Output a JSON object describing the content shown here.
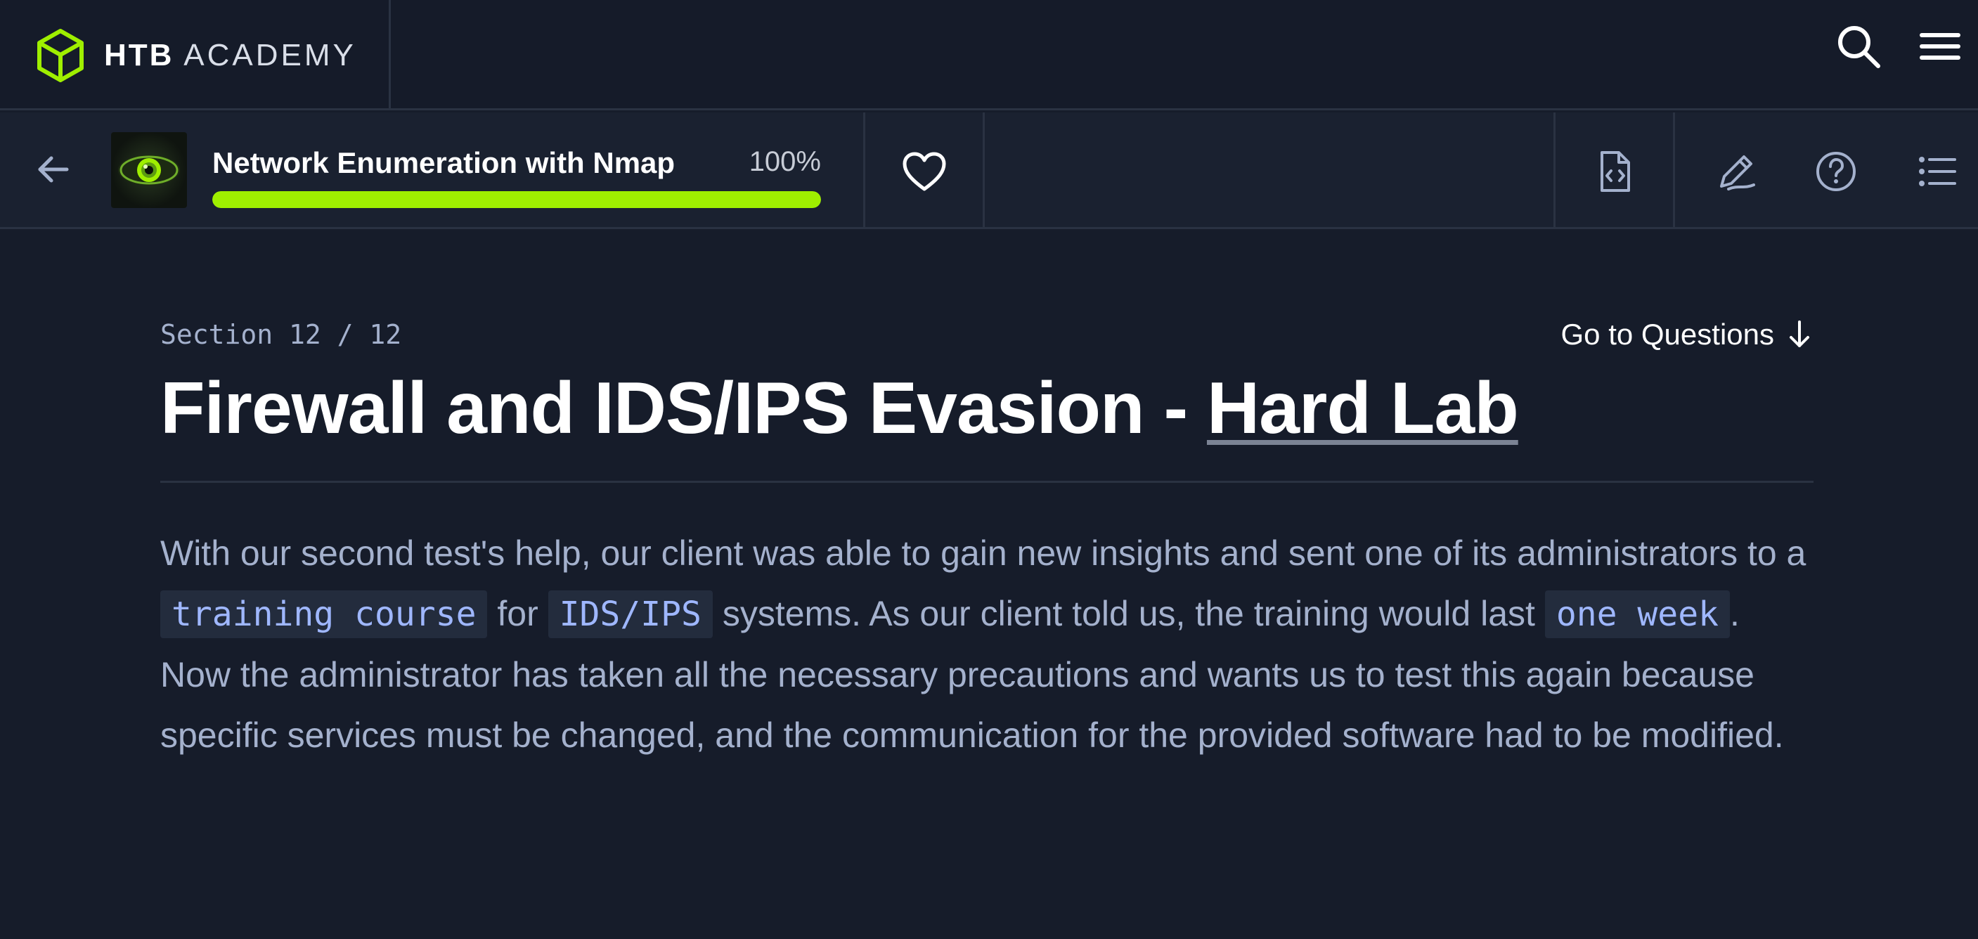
{
  "brand": {
    "name_bold": "HTB",
    "name_light": "ACADEMY"
  },
  "module": {
    "title": "Network Enumeration with Nmap",
    "progress_text": "100%",
    "progress_value": 1.0
  },
  "section": {
    "label": "Section 12 / 12",
    "go_to_questions": "Go to Questions",
    "title_main": "Firewall and IDS/IPS Evasion - ",
    "title_highlight": "Hard Lab"
  },
  "paragraph": {
    "t1": "With our second test's help, our client was able to gain new insights and sent one of its administrators to a ",
    "code1": "training course",
    "t2": " for ",
    "code2": "IDS/IPS",
    "t3": " systems. As our client told us, the training would last ",
    "code3": "one week",
    "t4": ". Now the administrator has taken all the necessary precautions and wants us to test this again because specific services must be changed, and the communication for the provided software had to be modified."
  },
  "icons": {
    "logo": "htb-cube-logo-icon",
    "search": "search-icon",
    "menu": "hamburger-menu-icon",
    "back": "arrow-left-icon",
    "favorite": "heart-icon",
    "cheatsheet": "file-code-icon",
    "notes": "pencil-edit-icon",
    "help": "question-circle-icon",
    "toc": "list-icon",
    "arrow_down": "arrow-down-icon"
  },
  "colors": {
    "background": "#161c2a",
    "accent_green": "#9fef00",
    "muted_text": "#a4b1cd",
    "code_text": "#9fb7ff"
  }
}
